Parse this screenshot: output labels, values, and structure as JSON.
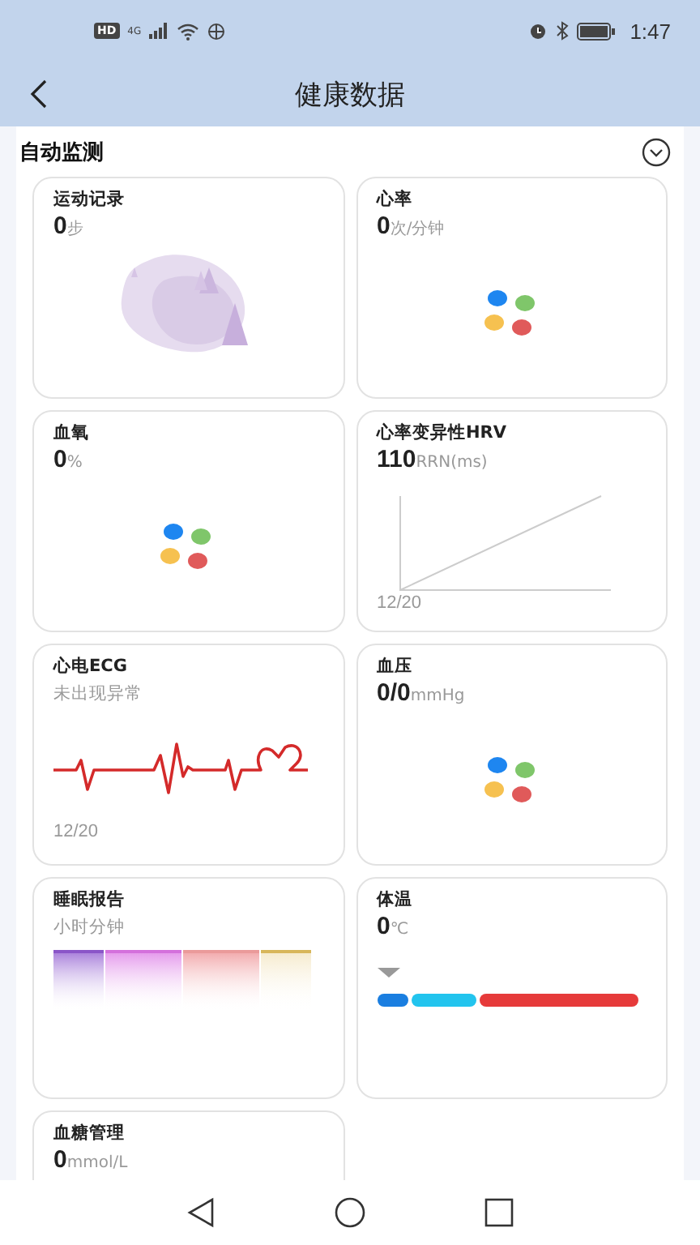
{
  "status_bar": {
    "badges": [
      "HD",
      "4G"
    ],
    "time": "1:47"
  },
  "header": {
    "title": "健康数据"
  },
  "section": {
    "title": "自动监测"
  },
  "cards": [
    {
      "kind": "steps",
      "title": "运动记录",
      "value": "0",
      "unit": "步"
    },
    {
      "kind": "dots",
      "title": "心率",
      "value": "0",
      "unit": "次/分钟"
    },
    {
      "kind": "dots",
      "title": "血氧",
      "value": "0",
      "unit": "%"
    },
    {
      "kind": "hrv",
      "title": "心率变异性HRV",
      "value": "110",
      "unit": "RRN(ms)",
      "date": "12/20"
    },
    {
      "kind": "ecg",
      "title": "心电ECG",
      "subtitle": "未出现异常",
      "date": "12/20"
    },
    {
      "kind": "dots",
      "title": "血压",
      "value": "0/0",
      "unit": "mmHg"
    },
    {
      "kind": "sleep",
      "title": "睡眠报告",
      "subtitle": "小时分钟"
    },
    {
      "kind": "temperature",
      "title": "体温",
      "value": "0",
      "unit": "℃"
    },
    {
      "kind": "plain",
      "title": "血糖管理",
      "value": "0",
      "unit": "mmol/L"
    }
  ]
}
